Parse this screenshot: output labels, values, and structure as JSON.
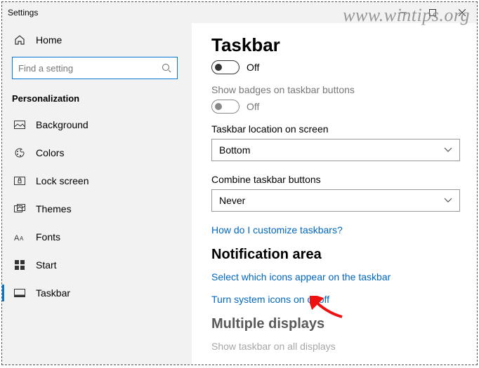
{
  "window": {
    "title": "Settings"
  },
  "sidebar": {
    "home": "Home",
    "search_placeholder": "Find a setting",
    "category": "Personalization",
    "items": [
      {
        "label": "Background"
      },
      {
        "label": "Colors"
      },
      {
        "label": "Lock screen"
      },
      {
        "label": "Themes"
      },
      {
        "label": "Fonts"
      },
      {
        "label": "Start"
      },
      {
        "label": "Taskbar"
      }
    ]
  },
  "main": {
    "title": "Taskbar",
    "toggle1_value": "Off",
    "badges_label": "Show badges on taskbar buttons",
    "toggle2_value": "Off",
    "location_label": "Taskbar location on screen",
    "location_value": "Bottom",
    "combine_label": "Combine taskbar buttons",
    "combine_value": "Never",
    "customize_link": "How do I customize taskbars?",
    "notif_title": "Notification area",
    "notif_link1": "Select which icons appear on the taskbar",
    "notif_link2": "Turn system icons on or off",
    "multi_title": "Multiple displays",
    "multi_label": "Show taskbar on all displays"
  },
  "watermark": "www.wintips.org"
}
